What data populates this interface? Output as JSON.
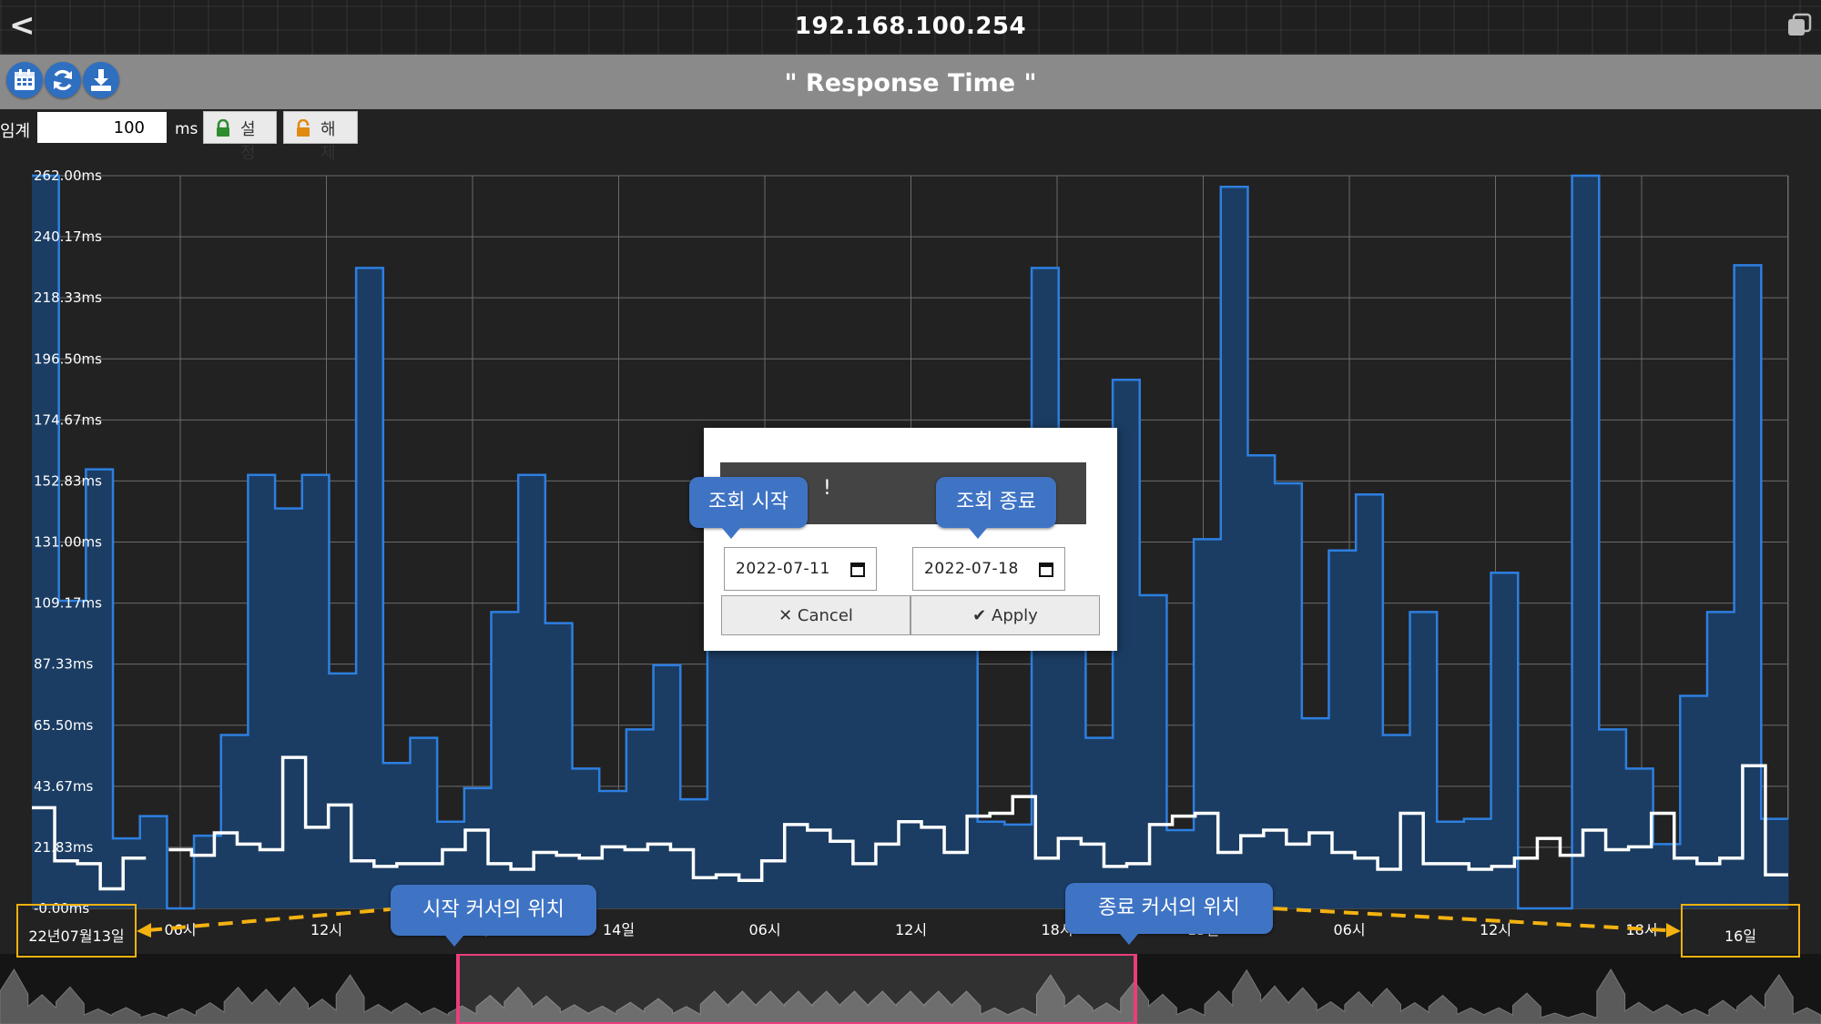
{
  "window": {
    "title": "192.168.100.254"
  },
  "toolbar": {
    "chart_title": "\" Response Time \"",
    "buttons": [
      "calendar-icon",
      "refresh-icon",
      "download-icon"
    ]
  },
  "threshold": {
    "label": "임계",
    "value": "100",
    "unit": "ms",
    "set_label": "설정",
    "release_label": "해제"
  },
  "chart_data": {
    "type": "area",
    "title": "\" Response Time \"",
    "y_tick_labels": [
      "262.00ms",
      "240.17ms",
      "218.33ms",
      "196.50ms",
      "174.67ms",
      "152.83ms",
      "131.00ms",
      "109.17ms",
      "87.33ms",
      "65.50ms",
      "43.67ms",
      "21.83ms",
      "-0.00ms"
    ],
    "ylim": [
      0,
      262
    ],
    "x_tick_labels": [
      "22년07월13일",
      "06시",
      "12시",
      "18시",
      "14일",
      "06시",
      "12시",
      "18시",
      "15일",
      "06시",
      "12시",
      "18시",
      "16일"
    ],
    "grid": true,
    "series": [
      {
        "name": "",
        "type": "step-area",
        "color": "#2d7fe0",
        "values": [
          262,
          110,
          157,
          25,
          33,
          0,
          26,
          62,
          155,
          143,
          155,
          84,
          229,
          52,
          61,
          31,
          43,
          106,
          155,
          102,
          50,
          42,
          64,
          87,
          39,
          131,
          131,
          131,
          131,
          131,
          131,
          131,
          131,
          131,
          131,
          31,
          30,
          229,
          108,
          61,
          189,
          112,
          28,
          132,
          258,
          162,
          152,
          68,
          128,
          148,
          62,
          106,
          31,
          32,
          120,
          0,
          0,
          262,
          64,
          50,
          23,
          76,
          106,
          230,
          32
        ]
      },
      {
        "name": "",
        "type": "step-line",
        "color": "#ffffff",
        "values": [
          36,
          17,
          16,
          7,
          18,
          null,
          21,
          19,
          27,
          23,
          21,
          54,
          29,
          37,
          17,
          15,
          16,
          16,
          21,
          28,
          16,
          14,
          20,
          19,
          18,
          22,
          21,
          23,
          21,
          11,
          12,
          10,
          17,
          30,
          28,
          24,
          16,
          23,
          31,
          29,
          20,
          33,
          34,
          40,
          18,
          25,
          23,
          15,
          16,
          30,
          33,
          34,
          20,
          26,
          28,
          23,
          27,
          20,
          18,
          14,
          34,
          16,
          16,
          14,
          15,
          18,
          25,
          19,
          28,
          21,
          22,
          34,
          18,
          16,
          18,
          51,
          12
        ]
      }
    ],
    "navigator": {
      "selection_start": "2022-07-13",
      "selection_end": "2022-07-16"
    }
  },
  "modal": {
    "header_fragment": "!",
    "start_date": "2022-07-11",
    "end_date": "2022-07-18",
    "cancel_label": "Cancel",
    "apply_label": "Apply"
  },
  "annotations": {
    "start_label": "조회 시작",
    "end_label": "조회 종료",
    "start_cursor": "시작 커서의 위치",
    "end_cursor": "종료 커서의 위치"
  },
  "colors": {
    "accent": "#3f74c5",
    "series_fill": "#1b3d63",
    "series_stroke": "#2d7fe0",
    "selection": "#ea3d7d",
    "range_highlight": "#f3b211"
  }
}
